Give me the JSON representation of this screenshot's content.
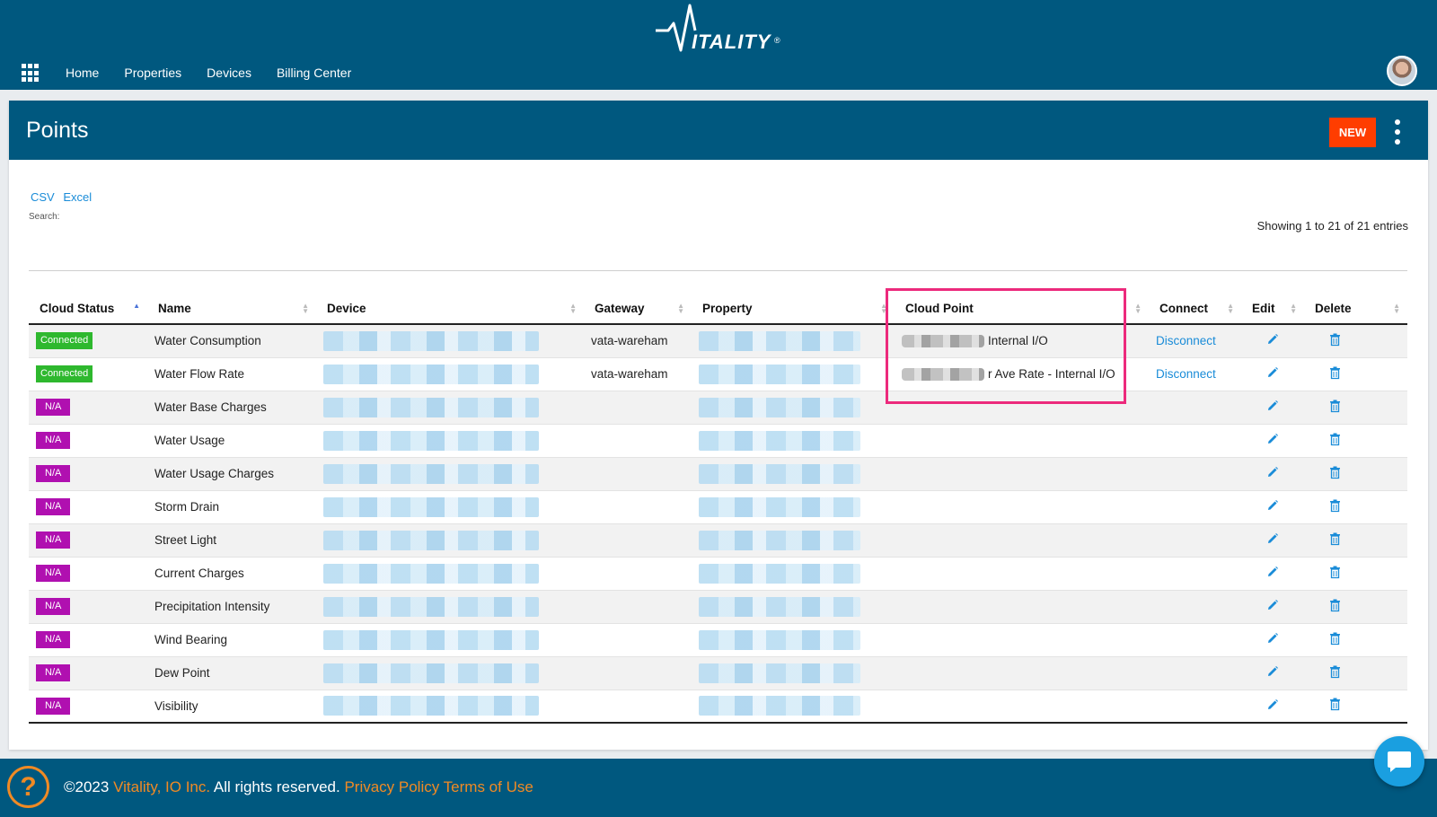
{
  "app": {
    "logo_text": "ITALITY",
    "logo_reg": "®"
  },
  "nav": {
    "items": [
      {
        "label": "Home"
      },
      {
        "label": "Properties"
      },
      {
        "label": "Devices"
      },
      {
        "label": "Billing Center"
      }
    ]
  },
  "page": {
    "title": "Points",
    "new_label": "NEW"
  },
  "toolbar": {
    "csv_label": "CSV",
    "excel_label": "Excel",
    "search_label": "Search:",
    "showing_text": "Showing 1 to 21 of 21 entries"
  },
  "table": {
    "headers": [
      "Cloud Status",
      "Name",
      "Device",
      "Gateway",
      "Property",
      "Cloud Point",
      "Connect",
      "Edit",
      "Delete"
    ],
    "rows": [
      {
        "status": "Connected",
        "status_type": "connected",
        "name": "Water Consumption",
        "gateway": "vata-wareham",
        "cloud_point": "Internal I/O",
        "connect": "Disconnect"
      },
      {
        "status": "Connected",
        "status_type": "connected",
        "name": "Water Flow Rate",
        "gateway": "vata-wareham",
        "cloud_point": "r Ave Rate - Internal I/O",
        "connect": "Disconnect"
      },
      {
        "status": "N/A",
        "status_type": "na",
        "name": "Water Base Charges",
        "gateway": "",
        "cloud_point": "",
        "connect": ""
      },
      {
        "status": "N/A",
        "status_type": "na",
        "name": "Water Usage",
        "gateway": "",
        "cloud_point": "",
        "connect": ""
      },
      {
        "status": "N/A",
        "status_type": "na",
        "name": "Water Usage Charges",
        "gateway": "",
        "cloud_point": "",
        "connect": ""
      },
      {
        "status": "N/A",
        "status_type": "na",
        "name": "Storm Drain",
        "gateway": "",
        "cloud_point": "",
        "connect": ""
      },
      {
        "status": "N/A",
        "status_type": "na",
        "name": "Street Light",
        "gateway": "",
        "cloud_point": "",
        "connect": ""
      },
      {
        "status": "N/A",
        "status_type": "na",
        "name": "Current Charges",
        "gateway": "",
        "cloud_point": "",
        "connect": ""
      },
      {
        "status": "N/A",
        "status_type": "na",
        "name": "Precipitation Intensity",
        "gateway": "",
        "cloud_point": "",
        "connect": ""
      },
      {
        "status": "N/A",
        "status_type": "na",
        "name": "Wind Bearing",
        "gateway": "",
        "cloud_point": "",
        "connect": ""
      },
      {
        "status": "N/A",
        "status_type": "na",
        "name": "Dew Point",
        "gateway": "",
        "cloud_point": "",
        "connect": ""
      },
      {
        "status": "N/A",
        "status_type": "na",
        "name": "Visibility",
        "gateway": "",
        "cloud_point": "",
        "connect": ""
      }
    ]
  },
  "footer": {
    "copyright": "©2023",
    "company": "Vitality, IO Inc.",
    "rights": "All rights reserved.",
    "privacy": "Privacy Policy",
    "terms": "Terms of Use"
  },
  "colors": {
    "header_bg": "#00587f",
    "new_button": "#ff3d00",
    "connected_badge": "#2eb82e",
    "na_badge": "#b010b0",
    "link": "#1a8cd8",
    "footer_accent": "#f08a24",
    "highlight_border": "#ec2a7c"
  },
  "icons": [
    "apps-grid-icon",
    "avatar",
    "kebab-menu-icon",
    "pencil-icon",
    "trash-icon",
    "help-icon",
    "chat-icon"
  ]
}
